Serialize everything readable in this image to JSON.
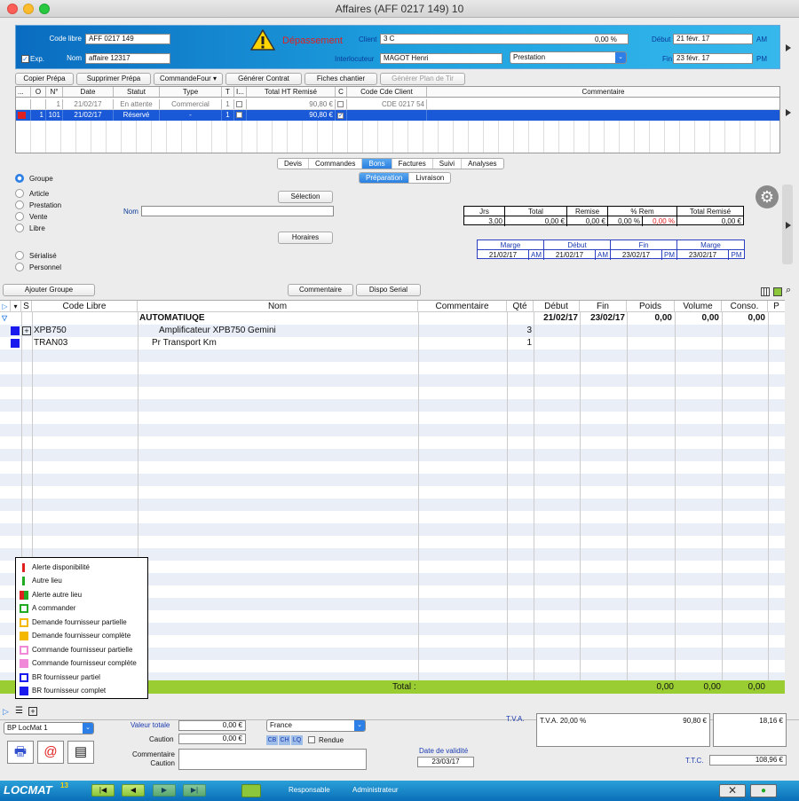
{
  "window": {
    "title": "Affaires (AFF 0217 149) 10"
  },
  "header": {
    "code_libre_label": "Code libre",
    "code_libre_value": "AFF 0217 149",
    "exp_label": "Exp.",
    "nom_label": "Nom",
    "nom_value": "affaire 12317",
    "warning": "Dépassement",
    "client_label": "Client",
    "client_value": "3 C",
    "client_amount": "0,00 %",
    "interlocuteur_label": "Interlocuteur",
    "interlocuteur_value": "MAGOT Henri",
    "prestation_value": "Prestation",
    "debut_label": "Début",
    "debut_value": "21 févr. 17",
    "debut_period": "AM",
    "fin_label": "Fin",
    "fin_value": "23 févr. 17",
    "fin_period": "PM"
  },
  "toolbar": [
    "Copier Prépa",
    "Supprimer Prépa",
    "CommandeFour",
    "Générer Contrat",
    "Fiches chantier",
    "Générer Plan de Tir"
  ],
  "prep_grid": {
    "columns": [
      "...",
      "O",
      "N°",
      "Date",
      "Statut",
      "Type",
      "T",
      "I...",
      "Total HT Remisé",
      "C",
      "Code Cde Client",
      "Commentaire"
    ],
    "rows": [
      {
        "o": "",
        "n": "1",
        "date": "21/02/17",
        "statut": "En attente",
        "type": "Commercial",
        "t": "1",
        "total": "90,80 €",
        "code": "CDE 0217 54"
      },
      {
        "o": "1",
        "n": "101",
        "date": "21/02/17",
        "statut": "Réservé",
        "type": "-",
        "t": "1",
        "total": "90,80 €",
        "code": ""
      }
    ]
  },
  "tabs": [
    "Devis",
    "Commandes",
    "Bons",
    "Factures",
    "Suivi",
    "Analyses"
  ],
  "subtabs": [
    "Préparation",
    "Livraison"
  ],
  "radios": {
    "groupe": "Groupe",
    "article": "Article",
    "prestation": "Prestation",
    "vente": "Vente",
    "libre": "Libre",
    "serialise": "Sérialisé",
    "personnel": "Personnel"
  },
  "selection_button": "Sélection",
  "horaires_button": "Horaires",
  "nom_label": "Nom",
  "summary": {
    "headers": [
      "Jrs",
      "Total",
      "Remise",
      "% Rem",
      "Total Remisé"
    ],
    "values": [
      "3,00",
      "0,00 €",
      "0,00 €",
      "0,00 %",
      "0,00 %",
      "0,00 €"
    ]
  },
  "dates": {
    "headers": [
      "Marge",
      "Début",
      "Fin",
      "Marge"
    ],
    "values": [
      "21/02/17",
      "AM",
      "21/02/17",
      "AM",
      "23/02/17",
      "PM",
      "23/02/17",
      "PM"
    ]
  },
  "actions": {
    "add_group": "Ajouter Groupe",
    "commentaire": "Commentaire",
    "dispo_serial": "Dispo Serial"
  },
  "main_grid": {
    "columns": [
      "S",
      "Code Libre",
      "Nom",
      "Commentaire",
      "Qté",
      "Début",
      "Fin",
      "Poids",
      "Volume",
      "Conso.",
      "P"
    ],
    "group": {
      "nom": "AUTOMATIUQE",
      "debut": "21/02/17",
      "fin": "23/02/17",
      "poids": "0,00",
      "volume": "0,00",
      "conso": "0,00"
    },
    "rows": [
      {
        "code": "XPB750",
        "nom": "Amplificateur XPB750 Gemini",
        "qte": "3"
      },
      {
        "code": "TRAN03",
        "nom": "Pr Transport Km",
        "qte": "1"
      }
    ],
    "total_label": "Total :",
    "total_poids": "0,00",
    "total_volume": "0,00",
    "total_conso": "0,00"
  },
  "legend": [
    {
      "label": "Alerte disponibilité",
      "color": "#e02020"
    },
    {
      "label": "Autre lieu",
      "color": "#22aa22"
    },
    {
      "label": "Alerte autre lieu",
      "color": "#e02020"
    },
    {
      "label": "A commander",
      "color": "#22aa22"
    },
    {
      "label": "Demande fournisseur partielle",
      "color": "#f5b800"
    },
    {
      "label": "Demande fournisseur complète",
      "color": "#f5b800"
    },
    {
      "label": "Commande fournisseur partielle",
      "color": "#f08ad8"
    },
    {
      "label": "Commande fournisseur complète",
      "color": "#f08ad8"
    },
    {
      "label": "BR fournisseur partiel",
      "color": "#1a1aee"
    },
    {
      "label": "BR fournisseur complet",
      "color": "#1a1aee"
    }
  ],
  "bottom": {
    "depot": "BP LocMat 1",
    "valeur_totale_label": "Valeur totale",
    "valeur_totale": "0,00 €",
    "caution_label": "Caution",
    "caution": "0,00 €",
    "commentaire_caution_label": "Commentaire Caution",
    "pays": "France",
    "cb": "CB",
    "ch": "CH",
    "lq": "LQ",
    "rendue": "Rendue",
    "date_validite_label": "Date de validité",
    "date_validite": "23/03/17",
    "tva_label": "T.V.A.",
    "tva_line": "T.V.A. 20,00 %",
    "tva_base": "90,80 €",
    "tva_amount": "18,16 €",
    "ttc_label": "T.T.C.",
    "ttc": "108,96 €"
  },
  "footer": {
    "brand": "LOCMAT",
    "version": "13",
    "responsable": "Responsable",
    "administrateur": "Administrateur"
  }
}
